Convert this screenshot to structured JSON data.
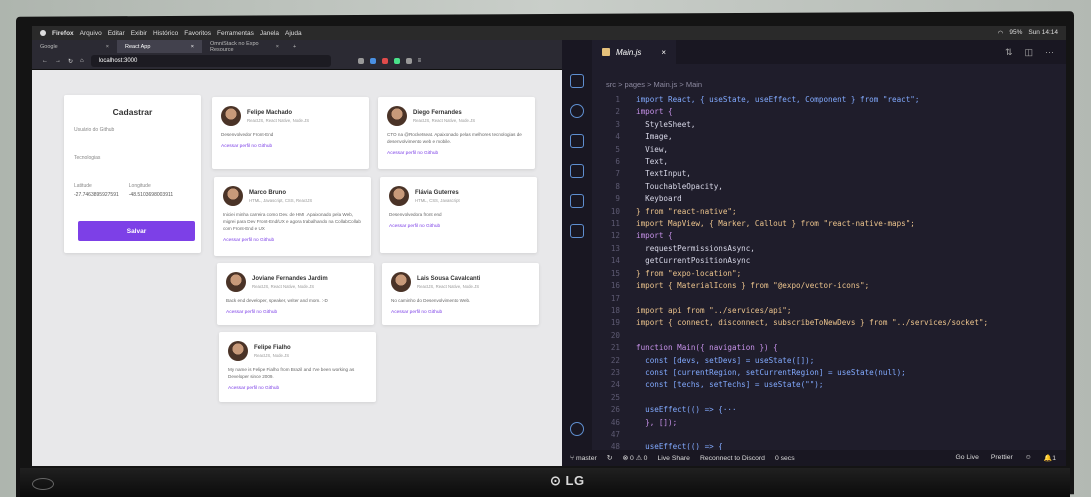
{
  "menubar": {
    "app": "Firefox",
    "items": [
      "Arquivo",
      "Editar",
      "Exibir",
      "Histórico",
      "Favoritos",
      "Ferramentas",
      "Janela",
      "Ajuda"
    ],
    "battery": "95%",
    "clock": "Sun 14:14"
  },
  "browser": {
    "tabs": [
      {
        "label": "Google"
      },
      {
        "label": "React App"
      },
      {
        "label": "OmniStack no Expo Resource"
      }
    ],
    "url": "localhost:3000"
  },
  "form": {
    "title": "Cadastrar",
    "github_label": "Usuário do Github",
    "techs_label": "Tecnologias",
    "lat_label": "Latitude",
    "lat_value": "-27.7463895927591",
    "lon_label": "Longitude",
    "lon_value": "-48.5103698003911",
    "submit": "Salvar"
  },
  "devs": [
    {
      "name": "Felipe Machado",
      "techs": "ReactJS, React Native, Node.JS",
      "bio": "Desenvolvedor Front-End",
      "link": "Acessar perfil no Github"
    },
    {
      "name": "Diego Fernandes",
      "techs": "ReactJS, React Native, Node.JS",
      "bio": "CTO na @Rocketseat. Apaixonado pelas melhores tecnologias de desenvolvimento web e mobile.",
      "link": "Acessar perfil no Github"
    },
    {
      "name": "Marco Bruno",
      "techs": "HTML, Javascript, CSS, ReactJS",
      "bio": "Iniciei minha carreira como Dev. de HMI .Apaixonado pela Web, migrei para Dev Front-End/UX e agora trabalhando na CollabCollab com Front-End e UX",
      "link": "Acessar perfil no Github"
    },
    {
      "name": "Flávia Guterres",
      "techs": "HTML, CSS, Javascript",
      "bio": "Desenvolvedora front end",
      "link": "Acessar perfil no Github"
    },
    {
      "name": "Joviane Fernandes Jardim",
      "techs": "ReactJS, React Native, Node.JS",
      "bio": "Back end developer, speaker, writer and mom. :-D",
      "link": "Acessar perfil no Github"
    },
    {
      "name": "Lais Sousa Cavalcanti",
      "techs": "ReactJS, React Native, Node.JS",
      "bio": "No caminho do Desenvolvimento Web.",
      "link": "Acessar perfil no Github"
    },
    {
      "name": "Felipe Fialho",
      "techs": "ReactJS, Node.JS",
      "bio": "My name is Felipe Fialho from Brazil and I've been working as Developer since 2009.",
      "link": "Acessar perfil no Github"
    }
  ],
  "editor": {
    "tab": "Main.js",
    "breadcrumb": "src  >  pages  >  Main.js  >  Main",
    "lines": [
      {
        "n": "1",
        "code": "import React, { useState, useEffect, Component } from \"react\";"
      },
      {
        "n": "2",
        "code": "import {"
      },
      {
        "n": "3",
        "code": "  StyleSheet,"
      },
      {
        "n": "4",
        "code": "  Image,"
      },
      {
        "n": "5",
        "code": "  View,"
      },
      {
        "n": "6",
        "code": "  Text,"
      },
      {
        "n": "7",
        "code": "  TextInput,"
      },
      {
        "n": "8",
        "code": "  TouchableOpacity,"
      },
      {
        "n": "9",
        "code": "  Keyboard"
      },
      {
        "n": "10",
        "code": "} from \"react-native\";"
      },
      {
        "n": "11",
        "code": "import MapView, { Marker, Callout } from \"react-native-maps\";"
      },
      {
        "n": "12",
        "code": "import {"
      },
      {
        "n": "13",
        "code": "  requestPermissionsAsync,"
      },
      {
        "n": "14",
        "code": "  getCurrentPositionAsync"
      },
      {
        "n": "15",
        "code": "} from \"expo-location\";"
      },
      {
        "n": "16",
        "code": "import { MaterialIcons } from \"@expo/vector-icons\";"
      },
      {
        "n": "17",
        "code": ""
      },
      {
        "n": "18",
        "code": "import api from \"../services/api\";"
      },
      {
        "n": "19",
        "code": "import { connect, disconnect, subscribeToNewDevs } from \"../services/socket\";"
      },
      {
        "n": "20",
        "code": ""
      },
      {
        "n": "21",
        "code": "function Main({ navigation }) {"
      },
      {
        "n": "22",
        "code": "  const [devs, setDevs] = useState([]);"
      },
      {
        "n": "23",
        "code": "  const [currentRegion, setCurrentRegion] = useState(null);"
      },
      {
        "n": "24",
        "code": "  const [techs, setTechs] = useState(\"\");"
      },
      {
        "n": "25",
        "code": ""
      },
      {
        "n": "26",
        "code": "  useEffect(() => {···"
      },
      {
        "n": "46",
        "code": "  }, []);"
      },
      {
        "n": "47",
        "code": ""
      },
      {
        "n": "48",
        "code": "  useEffect(() => {"
      }
    ]
  },
  "status": {
    "branch": "master",
    "problems": "⊗ 0 ⚠ 0",
    "liveshare": "Live Share",
    "discord": "Reconnect to Discord",
    "timer": "0 secs",
    "golive": "Go Live",
    "prettier": "Prettier",
    "notifications": "1"
  }
}
